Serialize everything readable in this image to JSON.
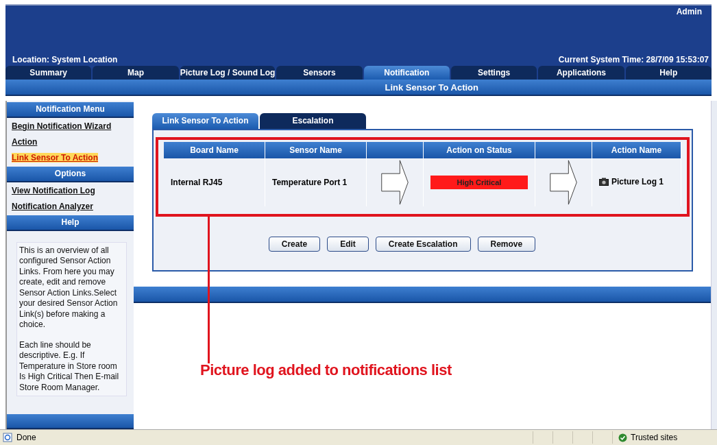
{
  "header": {
    "user": "Admin",
    "location": "Location: System Location",
    "time": "Current System Time: 28/7/09 15:53:07"
  },
  "tabs": [
    {
      "label": "Summary",
      "selected": false
    },
    {
      "label": "Map",
      "selected": false
    },
    {
      "label": "Picture Log / Sound Log",
      "selected": false
    },
    {
      "label": "Sensors",
      "selected": false
    },
    {
      "label": "Notification",
      "selected": true
    },
    {
      "label": "Settings",
      "selected": false
    },
    {
      "label": "Applications",
      "selected": false
    },
    {
      "label": "Help",
      "selected": false
    }
  ],
  "page_title": "Link Sensor To Action",
  "sidebar": [
    {
      "title": "Notification Menu",
      "items": [
        {
          "label": "Begin Notification Wizard",
          "selected": false
        },
        {
          "label": "Action",
          "selected": false
        },
        {
          "label": "Link Sensor To Action",
          "selected": true
        }
      ]
    },
    {
      "title": "Options",
      "items": [
        {
          "label": "View Notification Log",
          "selected": false
        },
        {
          "label": "Notification Analyzer",
          "selected": false
        }
      ]
    },
    {
      "title": "Help",
      "paragraphs": [
        "This is an overview of all configured Sensor Action Links. From here you may create, edit and remove Sensor Action Links.Select your desired Sensor Action Link(s) before making a choice.",
        "Each line should be descriptive. E.g. If Temperature in Store room Is High Critical Then E-mail Store Room Manager."
      ]
    }
  ],
  "subtabs": [
    {
      "label": "Link Sensor To Action",
      "selected": true
    },
    {
      "label": "Escalation",
      "selected": false
    }
  ],
  "table": {
    "columns": [
      "Board Name",
      "Sensor Name",
      "Action on Status",
      "Action Name"
    ],
    "rows": [
      {
        "board": "Internal RJ45",
        "sensor": "Temperature Port 1",
        "status": "High Critical",
        "color": "#ff1a1a",
        "action": "Picture Log 1"
      }
    ]
  },
  "buttons": [
    "Create",
    "Edit",
    "Create Escalation",
    "Remove"
  ],
  "annotation": "Picture log added to notifications list",
  "status_bar": {
    "left": "Done",
    "zone": "Trusted sites"
  }
}
